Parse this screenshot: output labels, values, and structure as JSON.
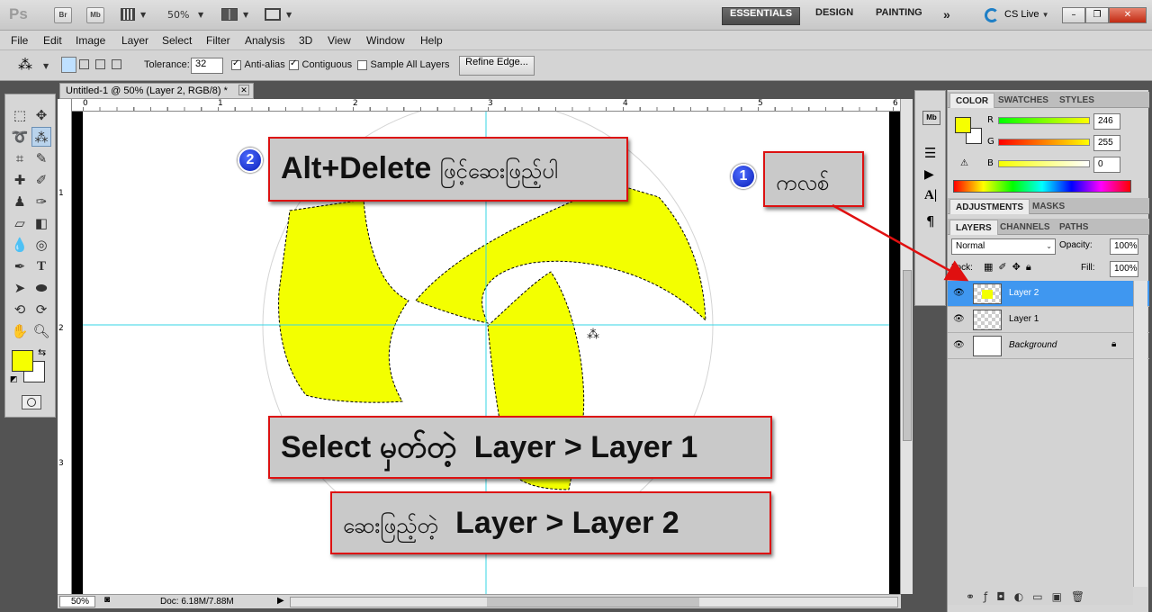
{
  "appbar": {
    "logo": "Ps",
    "bridge_btn": "Br",
    "minibridge_btn": "Mb",
    "zoom": "50%",
    "workspaces": [
      "ESSENTIALS",
      "DESIGN",
      "PAINTING"
    ],
    "more": "»",
    "cslive": "CS Live"
  },
  "menu": [
    "File",
    "Edit",
    "Image",
    "Layer",
    "Select",
    "Filter",
    "Analysis",
    "3D",
    "View",
    "Window",
    "Help"
  ],
  "options": {
    "tolerance_label": "Tolerance:",
    "tolerance_value": "32",
    "antialias_label": "Anti-alias",
    "contiguous_label": "Contiguous",
    "sample_all_label": "Sample All Layers",
    "refine_btn": "Refine Edge..."
  },
  "document": {
    "tab_title": "Untitled-1 @ 50% (Layer 2, RGB/8) *",
    "ruler_top": [
      "0",
      "1",
      "2",
      "3",
      "4",
      "5",
      "6"
    ],
    "ruler_left": [
      "1",
      "2",
      "3"
    ],
    "status_zoom": "50%",
    "status_doc": "Doc: 6.18M/7.88M"
  },
  "color_panel": {
    "tabs": [
      "COLOR",
      "SWATCHES",
      "STYLES"
    ],
    "r_label": "R",
    "r_value": "246",
    "g_label": "G",
    "g_value": "255",
    "b_label": "B",
    "b_value": "0",
    "fg_color": "#f6ff00"
  },
  "adjust_panel": {
    "tabs": [
      "ADJUSTMENTS",
      "MASKS"
    ]
  },
  "layers_panel": {
    "tabs": [
      "LAYERS",
      "CHANNELS",
      "PATHS"
    ],
    "blend_mode": "Normal",
    "opacity_label": "Opacity:",
    "opacity_value": "100%",
    "lock_label": "Lock:",
    "fill_label": "Fill:",
    "fill_value": "100%",
    "layers": [
      "Layer 2",
      "Layer 1",
      "Background"
    ]
  },
  "annotations": {
    "badge1": "1",
    "badge2": "2",
    "note1": "ကလစ်",
    "note2_main": "Alt+Delete",
    "note2_my": "ဖြင့်ဆေးဖြည့်ပါ",
    "note3_my": "Select မှတ်တဲ့",
    "note3_main": "Layer > Layer 1",
    "note4_my": "ဆေးဖြည့်တဲ့",
    "note4_main": "Layer > Layer 2"
  }
}
